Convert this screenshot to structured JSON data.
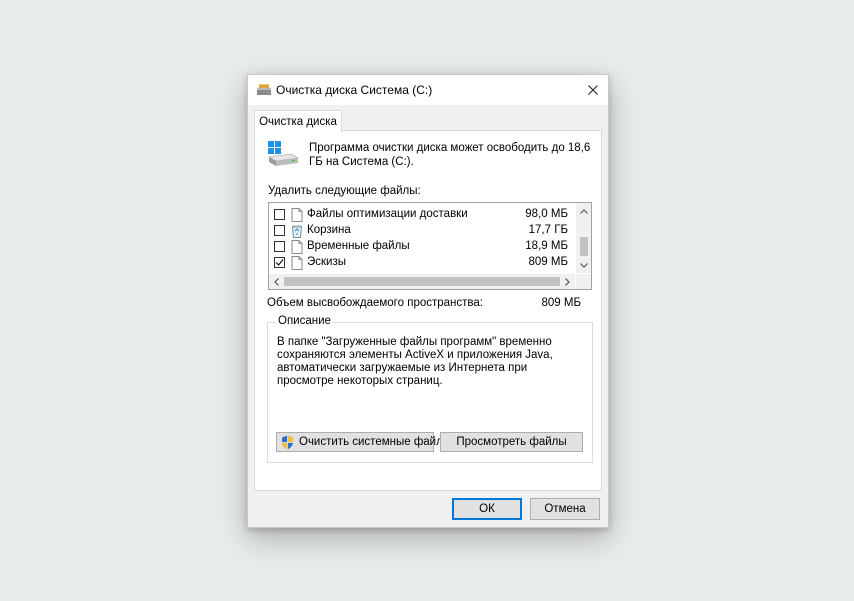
{
  "window": {
    "title": "Очистка диска Система (C:)",
    "title_icon": "disk-cleanup-icon",
    "close_icon": "close-icon"
  },
  "tab": {
    "label": "Очистка диска"
  },
  "intro": {
    "text": "Программа очистки диска может освободить до 18,6 ГБ на Система (C:).",
    "icon": "drive-icon"
  },
  "files_label": "Удалить следующие файлы:",
  "files": [
    {
      "name": "Файлы оптимизации доставки",
      "size": "98,0 МБ",
      "checked": false,
      "icon": "file-icon"
    },
    {
      "name": "Корзина",
      "size": "17,7 ГБ",
      "checked": false,
      "icon": "recycle-bin-icon"
    },
    {
      "name": "Временные файлы",
      "size": "18,9 МБ",
      "checked": false,
      "icon": "file-icon"
    },
    {
      "name": "Эскизы",
      "size": "809 МБ",
      "checked": true,
      "icon": "file-icon"
    }
  ],
  "space": {
    "label": "Объем высвобождаемого пространства:",
    "value": "809 МБ"
  },
  "description": {
    "legend": "Описание",
    "text": "В папке \"Загруженные файлы программ\" временно сохраняются элементы ActiveX и приложения Java, автоматически загружаемые из Интернета при просмотре некоторых страниц."
  },
  "buttons": {
    "clean_system": "Очистить системные файлы",
    "view_files": "Просмотреть файлы",
    "ok": "ОК",
    "cancel": "Отмена"
  },
  "colors": {
    "accent": "#0078d7",
    "window_bg": "#f0f0f0",
    "panel_bg": "#ffffff",
    "button_bg": "#e1e1e1"
  }
}
